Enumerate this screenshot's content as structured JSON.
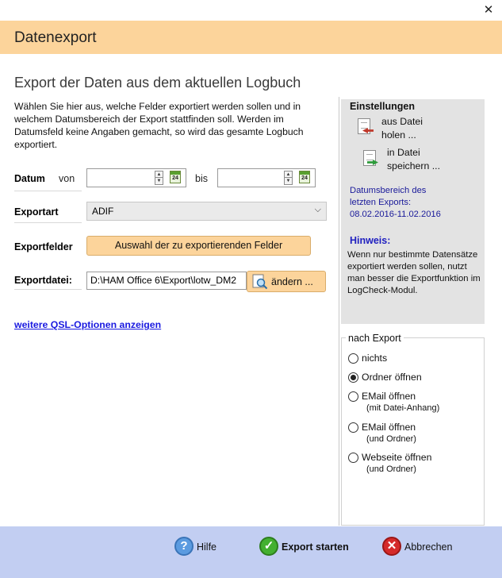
{
  "window": {
    "close_glyph": "✕",
    "title": "Datenexport"
  },
  "main": {
    "subtitle": "Export der Daten aus dem aktuellen Logbuch",
    "description": "Wählen Sie hier aus, welche Felder exportiert werden sollen und in welchem Datumsbereich der Export stattfinden soll. Werden im Datumsfeld keine Angaben gemacht, so wird das gesamte Logbuch exportiert."
  },
  "form": {
    "datum_label": "Datum",
    "von_label": "von",
    "bis_label": "bis",
    "date_from": "",
    "date_to": "",
    "exportart_label": "Exportart",
    "exportart_value": "ADIF",
    "exportfelder_label": "Exportfelder",
    "exportfelder_button": "Auswahl der zu exportierenden Felder",
    "exportdatei_label": "Exportdatei:",
    "exportdatei_value": "D:\\HAM Office 6\\Export\\lotw_DM2",
    "aendern_button": "ändern ...",
    "more_options_link": "weitere QSL-Optionen anzeigen"
  },
  "settings": {
    "title": "Einstellungen",
    "load_line1": "aus Datei",
    "load_line2": "holen ...",
    "save_line1": "in Datei",
    "save_line2": "speichern ...",
    "range_line1": "Datumsbereich des",
    "range_line2": "letzten Exports:",
    "range_line3": "08.02.2016-11.02.2016",
    "hint_title": "Hinweis:",
    "hint_text": "Wenn nur bestimmte Datensätze exportiert werden sollen, nutzt man besser die Exportfunktion im LogCheck-Modul."
  },
  "after_export": {
    "title": "nach Export",
    "options": [
      {
        "label": "nichts",
        "sub": "",
        "selected": false
      },
      {
        "label": "Ordner öffnen",
        "sub": "",
        "selected": true
      },
      {
        "label": "EMail öffnen",
        "sub": "(mit Datei-Anhang)",
        "selected": false
      },
      {
        "label": "EMail öffnen",
        "sub": "(und Ordner)",
        "selected": false
      },
      {
        "label": "Webseite öffnen",
        "sub": "(und Ordner)",
        "selected": false
      }
    ]
  },
  "footer": {
    "help_label": "Hilfe",
    "export_label": "Export starten",
    "cancel_label": "Abbrechen"
  },
  "colors": {
    "title_bar": "#fcd49b",
    "footer": "#c2cef2",
    "panel": "#e3e3e3",
    "link": "#1a1ae0"
  },
  "icons": {
    "help": "help-icon",
    "ok": "check-icon",
    "cancel": "cancel-icon",
    "calendar": "calendar-icon",
    "document": "document-icon",
    "magnifier": "magnifier-icon"
  }
}
